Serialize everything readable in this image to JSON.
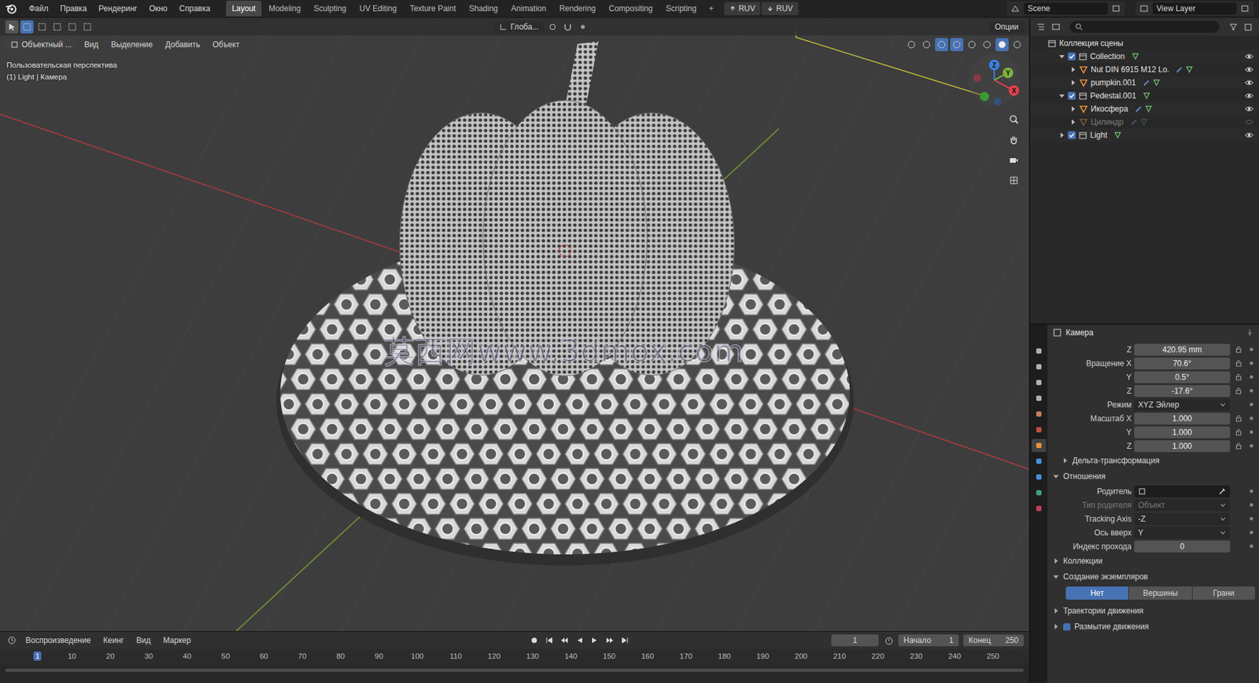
{
  "topbar": {
    "menus": [
      "Файл",
      "Правка",
      "Рендеринг",
      "Окно",
      "Справка"
    ],
    "workspaces": [
      {
        "label": "Layout",
        "selected": true
      },
      {
        "label": "Modeling",
        "selected": false
      },
      {
        "label": "Sculpting",
        "selected": false
      },
      {
        "label": "UV Editing",
        "selected": false
      },
      {
        "label": "Texture Paint",
        "selected": false
      },
      {
        "label": "Shading",
        "selected": false
      },
      {
        "label": "Animation",
        "selected": false
      },
      {
        "label": "Rendering",
        "selected": false
      },
      {
        "label": "Compositing",
        "selected": false
      },
      {
        "label": "Scripting",
        "selected": false
      }
    ],
    "add_tab": "+",
    "ruv_buttons": [
      "RUV",
      "RUV"
    ],
    "scene": "Scene",
    "view_layer": "View Layer"
  },
  "tool_header": {
    "transform": "Глоба...",
    "options": "Опции"
  },
  "viewport_header": {
    "mode": "Объектный ...",
    "menus": [
      "Вид",
      "Выделение",
      "Добавить",
      "Объект"
    ]
  },
  "viewport": {
    "perspective": "Пользовательская перспектива",
    "context": "(1) Light | Камера",
    "watermark": "莫西网www.3dmox.com",
    "gizmo": [
      {
        "axis": "X",
        "color": "#e0414f"
      },
      {
        "axis": "Y",
        "color": "#7db33d"
      },
      {
        "axis": "Z",
        "color": "#3d7fe0"
      }
    ]
  },
  "outliner": {
    "items": [
      {
        "name": "Коллекция сцены",
        "depth": 0,
        "kind": "scene",
        "expanded": true,
        "checked": true,
        "visible": true,
        "disabled": false
      },
      {
        "name": "Collection",
        "depth": 1,
        "kind": "collection",
        "expanded": true,
        "checked": true,
        "visible": true,
        "disabled": false
      },
      {
        "name": "Nut DIN 6915 M12 Lo.",
        "depth": 2,
        "kind": "object",
        "expanded": false,
        "checked": true,
        "visible": true,
        "disabled": false
      },
      {
        "name": "pumpkin.001",
        "depth": 2,
        "kind": "object",
        "expanded": false,
        "checked": true,
        "visible": true,
        "disabled": false
      },
      {
        "name": "Pedestal.001",
        "depth": 1,
        "kind": "collection",
        "expanded": true,
        "checked": true,
        "visible": true,
        "disabled": false
      },
      {
        "name": "Икосфера",
        "depth": 2,
        "kind": "object",
        "expanded": false,
        "checked": true,
        "visible": true,
        "disabled": false
      },
      {
        "name": "Цилиндр",
        "depth": 2,
        "kind": "object",
        "expanded": false,
        "checked": true,
        "visible": false,
        "disabled": true
      },
      {
        "name": "Light",
        "depth": 1,
        "kind": "collection",
        "expanded": false,
        "checked": true,
        "visible": true,
        "disabled": false
      }
    ]
  },
  "property_tabs": [
    {
      "selected": false,
      "color": "#b0b0b0"
    },
    {
      "selected": false,
      "color": "#b0b0b0"
    },
    {
      "selected": false,
      "color": "#b0b0b0"
    },
    {
      "selected": false,
      "color": "#b0b0b0"
    },
    {
      "selected": false,
      "color": "#c77d5a"
    },
    {
      "selected": false,
      "color": "#c0503e"
    },
    {
      "selected": true,
      "color": "#e8913a"
    },
    {
      "selected": false,
      "color": "#4a90d9"
    },
    {
      "selected": false,
      "color": "#4a90d9"
    },
    {
      "selected": false,
      "color": "#3ea080"
    },
    {
      "selected": false,
      "color": "#c0405a"
    }
  ],
  "properties": {
    "object": "Камера",
    "rows": [
      {
        "kind": "field",
        "label": "Z",
        "value": "420.95 mm",
        "lock": true,
        "disabled": false
      },
      {
        "kind": "field",
        "label": "Вращение X",
        "value": "70.6°",
        "lock": true,
        "disabled": false
      },
      {
        "kind": "field",
        "label": "Y",
        "value": "0.5°",
        "lock": true,
        "disabled": false
      },
      {
        "kind": "field",
        "label": "Z",
        "value": "-17.6°",
        "lock": true,
        "disabled": false
      },
      {
        "kind": "dropdown",
        "label": "Режим",
        "value": "XYZ Эйлер",
        "lock": false,
        "disabled": false
      },
      {
        "kind": "field",
        "label": "Масштаб X",
        "value": "1.000",
        "lock": true,
        "disabled": false
      },
      {
        "kind": "field",
        "label": "Y",
        "value": "1.000",
        "lock": true,
        "disabled": false
      },
      {
        "kind": "field",
        "label": "Z",
        "value": "1.000",
        "lock": true,
        "disabled": false
      },
      {
        "kind": "section",
        "label": "Дельта-трансформация",
        "expanded": false,
        "depth": 1,
        "disabled": false
      },
      {
        "kind": "section",
        "label": "Отношения",
        "expanded": true,
        "depth": 0,
        "disabled": false
      },
      {
        "kind": "object",
        "label": "Родитель",
        "value": "",
        "lock": false,
        "disabled": false
      },
      {
        "kind": "dropdown",
        "label": "Тип родителя",
        "value": "Объект",
        "lock": false,
        "disabled": true
      },
      {
        "kind": "dropdown",
        "label": "Tracking Axis",
        "value": "-Z",
        "lock": false,
        "disabled": false
      },
      {
        "kind": "dropdown",
        "label": "Ось вверх",
        "value": "Y",
        "lock": false,
        "disabled": false
      },
      {
        "kind": "field",
        "label": "Индекс прохода",
        "value": "0",
        "lock": false,
        "disabled": false
      },
      {
        "kind": "section",
        "label": "Коллекции",
        "expanded": false,
        "depth": 0,
        "disabled": false
      },
      {
        "kind": "section",
        "label": "Создание экземпляров",
        "expanded": true,
        "depth": 0,
        "disabled": false
      },
      {
        "kind": "segmented",
        "options": [
          {
            "label": "Нет",
            "selected": true
          },
          {
            "label": "Вершины",
            "selected": false
          },
          {
            "label": "Грани",
            "selected": false
          }
        ],
        "disabled": false
      },
      {
        "kind": "section",
        "label": "Траектории движения",
        "expanded": false,
        "depth": 0,
        "disabled": false
      },
      {
        "kind": "checksection",
        "label": "Размытие движения",
        "expanded": false,
        "checked": true,
        "depth": 0,
        "disabled": false
      }
    ]
  },
  "timeline": {
    "menus": [
      "Воспроизведение",
      "Кеинг",
      "Вид",
      "Маркер"
    ],
    "current_frame": "1",
    "start_label": "Начало",
    "start": "1",
    "end_label": "Конец",
    "end": "250",
    "ruler": [
      {
        "label": "1",
        "selected": true
      },
      {
        "label": "10",
        "selected": false
      },
      {
        "label": "20",
        "selected": false
      },
      {
        "label": "30",
        "selected": false
      },
      {
        "label": "40",
        "selected": false
      },
      {
        "label": "50",
        "selected": false
      },
      {
        "label": "60",
        "selected": false
      },
      {
        "label": "70",
        "selected": false
      },
      {
        "label": "80",
        "selected": false
      },
      {
        "label": "90",
        "selected": false
      },
      {
        "label": "100",
        "selected": false
      },
      {
        "label": "110",
        "selected": false
      },
      {
        "label": "120",
        "selected": false
      },
      {
        "label": "130",
        "selected": false
      },
      {
        "label": "140",
        "selected": false
      },
      {
        "label": "150",
        "selected": false
      },
      {
        "label": "160",
        "selected": false
      },
      {
        "label": "170",
        "selected": false
      },
      {
        "label": "180",
        "selected": false
      },
      {
        "label": "190",
        "selected": false
      },
      {
        "label": "200",
        "selected": false
      },
      {
        "label": "210",
        "selected": false
      },
      {
        "label": "220",
        "selected": false
      },
      {
        "label": "230",
        "selected": false
      },
      {
        "label": "240",
        "selected": false
      },
      {
        "label": "250",
        "selected": false
      }
    ]
  }
}
